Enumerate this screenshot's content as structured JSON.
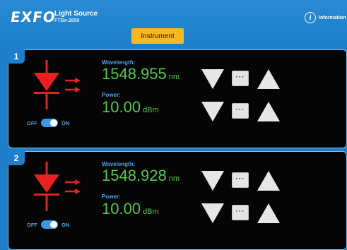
{
  "header": {
    "logo": "EXFO",
    "app_title": "Light Source",
    "app_subtitle": "FTBx-2850",
    "info_label": "Information",
    "info_icon": "info-circle-icon",
    "instrument_button": "Instrument"
  },
  "sources": [
    {
      "number": "1",
      "wavelength_label": "Wavelength:",
      "wavelength_value": "1548.955",
      "wavelength_unit": "nm",
      "power_label": "Power:",
      "power_value": "10.00",
      "power_unit": "dBm",
      "toggle_off_label": "OFF",
      "toggle_on_label": "ON",
      "toggle_state": "on",
      "dots_label": "···"
    },
    {
      "number": "2",
      "wavelength_label": "Wavelength:",
      "wavelength_value": "1548.928",
      "wavelength_unit": "nm",
      "power_label": "Power:",
      "power_value": "10.00",
      "power_unit": "dBm",
      "toggle_off_label": "OFF",
      "toggle_on_label": "ON",
      "toggle_state": "on",
      "dots_label": "···"
    }
  ],
  "colors": {
    "brand_blue": "#1d7fc9",
    "accent_yellow": "#f5b820",
    "laser_red": "#e82020",
    "value_green": "#52c84a",
    "label_blue": "#4aa3e6"
  }
}
